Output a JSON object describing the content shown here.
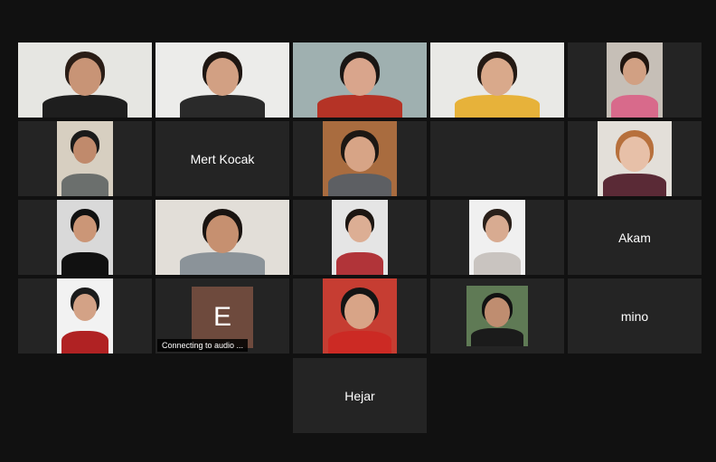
{
  "participants": [
    {
      "kind": "video",
      "skin": "#c89476",
      "hair": "#2a1d16",
      "shirt": "#1e1e1e",
      "bg": "#e6e6e2"
    },
    {
      "kind": "video",
      "skin": "#d2a083",
      "hair": "#1e1612",
      "shirt": "#2a2a2a",
      "bg": "#ececea"
    },
    {
      "kind": "video",
      "skin": "#d9a58c",
      "hair": "#1a1614",
      "shirt": "#b53326",
      "bg": "#9fb0b0",
      "active": true
    },
    {
      "kind": "video",
      "skin": "#d9a98b",
      "hair": "#241a14",
      "shirt": "#e7b23a",
      "bg": "#e9e9e6"
    },
    {
      "kind": "video",
      "skin": "#d1a083",
      "hair": "#20150f",
      "shirt": "#d86a8b",
      "bg": "#c6bfb7"
    },
    {
      "kind": "video",
      "skin": "#c08a6c",
      "hair": "#1a1a1a",
      "shirt": "#6b6f6d",
      "bg": "#d7cfc1"
    },
    {
      "kind": "name",
      "name": "Mert Kocak"
    },
    {
      "kind": "video",
      "skin": "#d7a486",
      "hair": "#1c1713",
      "shirt": "#5d5f63",
      "bg": "#a96c3f"
    },
    {
      "kind": "empty"
    },
    {
      "kind": "video",
      "skin": "#e7c0a8",
      "hair": "#b7703c",
      "shirt": "#5a2a36",
      "bg": "#e3dfd9"
    },
    {
      "kind": "video",
      "skin": "#cb9677",
      "hair": "#111111",
      "shirt": "#111111",
      "bg": "#d9d9d9"
    },
    {
      "kind": "video",
      "skin": "#c69070",
      "hair": "#1a1411",
      "shirt": "#8b9399",
      "bg": "#e2ded8"
    },
    {
      "kind": "video",
      "skin": "#dcae94",
      "hair": "#1d1612",
      "shirt": "#b13439",
      "bg": "#e5e5e5"
    },
    {
      "kind": "video",
      "skin": "#d8ab91",
      "hair": "#2a201a",
      "shirt": "#c9c4c0",
      "bg": "#f0f0f0"
    },
    {
      "kind": "name",
      "name": "Akam"
    },
    {
      "kind": "video",
      "skin": "#d3a286",
      "hair": "#1b1b1b",
      "shirt": "#b02223",
      "bg": "#f2f2f2"
    },
    {
      "kind": "avatar",
      "initial": "E",
      "status": "Connecting to audio ..."
    },
    {
      "kind": "video",
      "skin": "#d8a487",
      "hair": "#141414",
      "shirt": "#cc2a24",
      "bg": "#c63d32"
    },
    {
      "kind": "video",
      "skin": "#bf8d70",
      "hair": "#121212",
      "shirt": "#1b1b1b",
      "bg": "#5f7a55"
    },
    {
      "kind": "name",
      "name": "mino"
    },
    {
      "kind": "name",
      "name": "Hejar"
    }
  ]
}
